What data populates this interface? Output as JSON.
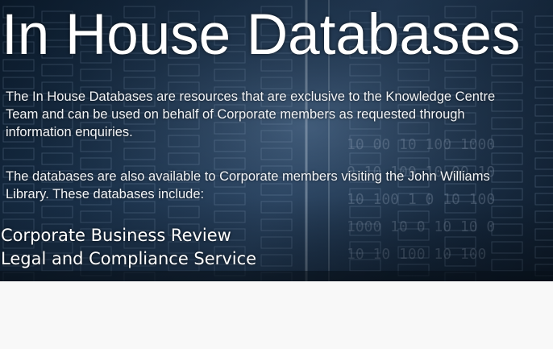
{
  "banner": {
    "title": "In House Databases",
    "paragraph_1": {
      "line_1": "The In House Databases are resources that are exclusive to the Knowledge Centre",
      "line_2": "Team and can be used on behalf of Corporate members as requested through",
      "line_3": "information enquiries."
    },
    "paragraph_2": {
      "line_1": "The databases are also available to Corporate members visiting the John Williams",
      "line_2": "Library. These databases include:"
    },
    "databases": [
      "Corporate Business Review",
      "Legal and Compliance Service"
    ],
    "colors": {
      "background_dark": "#0b1c2e",
      "background_mid": "#26405e",
      "text": "#ffffff",
      "page_background": "#f8f8f8"
    }
  }
}
